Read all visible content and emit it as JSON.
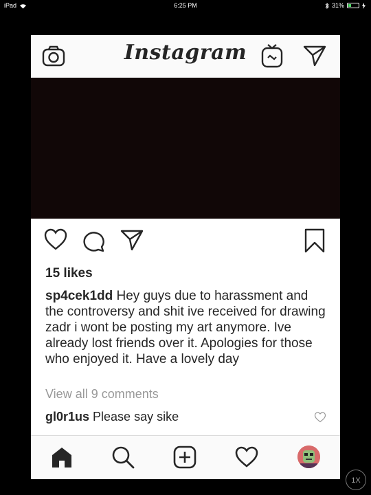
{
  "status_bar": {
    "device": "iPad",
    "time": "6:25 PM",
    "battery_text": "31%",
    "battery_level": 0.31,
    "icons": [
      "wifi-icon",
      "bluetooth-icon",
      "battery-icon",
      "charging-icon"
    ]
  },
  "header": {
    "logo_text": "Instagram",
    "icons": [
      "camera-icon",
      "igtv-icon",
      "direct-message-icon"
    ]
  },
  "post": {
    "likes": "15 likes",
    "username": "sp4cek1dd",
    "caption": " Hey guys due to harassment and the controversy and shit ive received for drawing zadr i wont be posting my art anymore. Ive already lost friends over it. Apologies for those who enjoyed it. Have a lovely day",
    "view_comments": "View all 9 comments",
    "comments": [
      {
        "username": "gl0r1us",
        "text": " Please say sike"
      }
    ],
    "action_icons": [
      "heart-icon",
      "comment-icon",
      "share-icon",
      "bookmark-icon"
    ]
  },
  "bottom_nav": {
    "items": [
      "home-icon",
      "search-icon",
      "add-post-icon",
      "activity-icon",
      "profile-avatar"
    ]
  },
  "zoom_badge": "1X",
  "colors": {
    "background": "#000000",
    "app_bg": "#ffffff",
    "bar_bg": "#fafafa",
    "text": "#262626",
    "muted": "#999999",
    "media_bg": "#110707",
    "battery_green": "#4cd964"
  }
}
